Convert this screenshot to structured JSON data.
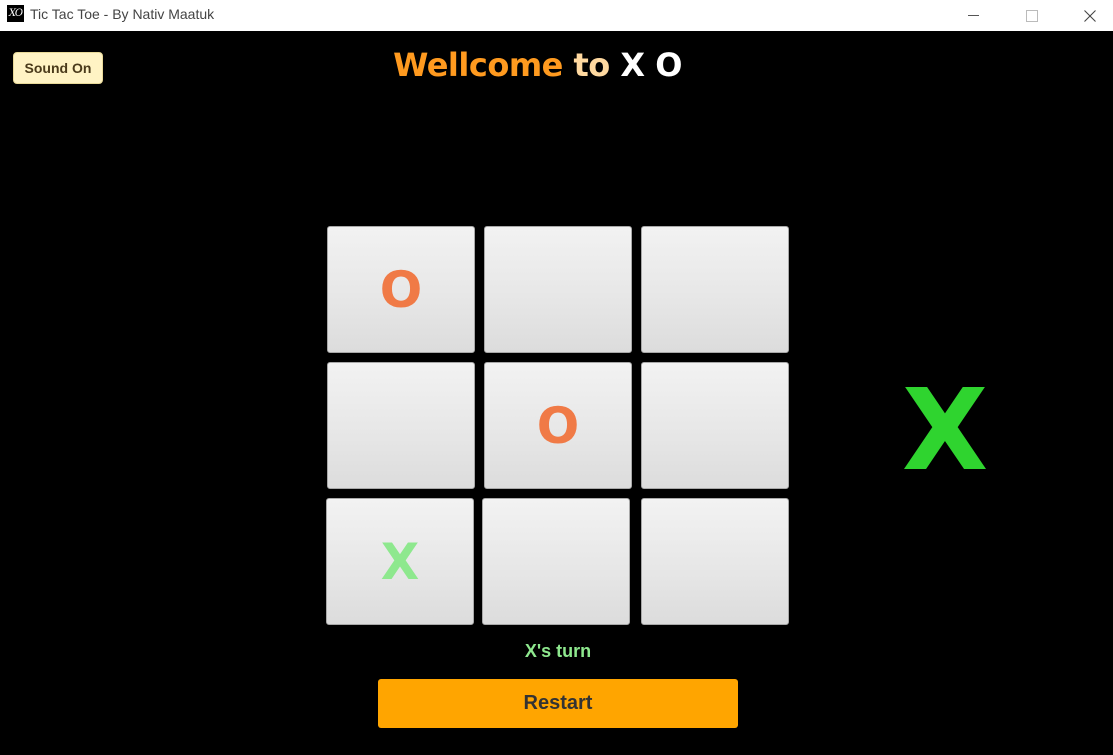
{
  "window": {
    "title": "Tic Tac Toe - By Nativ Maatuk",
    "icon": "XO"
  },
  "sound_button": {
    "label": "Sound On"
  },
  "heading": {
    "part1": "Wellcome",
    "part2": "to",
    "part3": "X O"
  },
  "board": {
    "cells": [
      "O",
      "",
      "",
      "",
      "O",
      "",
      "X",
      "",
      ""
    ]
  },
  "current_player": "X",
  "status": "X's turn",
  "restart_button": {
    "label": "Restart"
  },
  "colors": {
    "o_mark": "#f07a46",
    "x_mark": "#8ee88e",
    "big_x": "#2fd42f",
    "restart": "#ffa500",
    "title_orange": "#ff9a1f"
  }
}
